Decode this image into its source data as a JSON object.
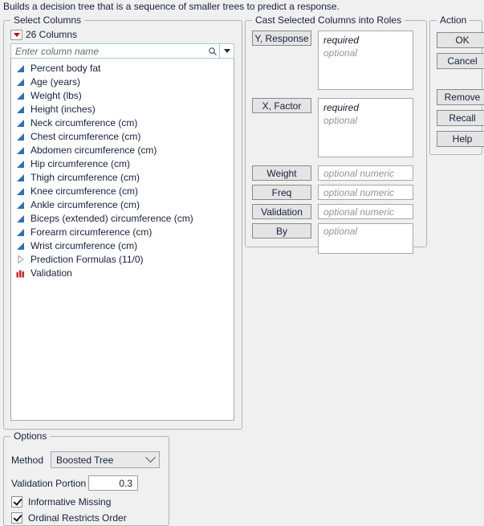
{
  "description": "Builds a decision tree that is a sequence of smaller trees to predict a response.",
  "select_columns": {
    "legend": "Select Columns",
    "column_count_label": "26 Columns",
    "search_placeholder": "Enter column name",
    "search_value": "",
    "items": [
      {
        "label": "Percent body fat",
        "icon": "continuous-icon"
      },
      {
        "label": "Age (years)",
        "icon": "continuous-icon"
      },
      {
        "label": "Weight (lbs)",
        "icon": "continuous-icon"
      },
      {
        "label": "Height (inches)",
        "icon": "continuous-icon"
      },
      {
        "label": "Neck circumference (cm)",
        "icon": "continuous-icon"
      },
      {
        "label": "Chest circumference (cm)",
        "icon": "continuous-icon"
      },
      {
        "label": "Abdomen circumference (cm)",
        "icon": "continuous-icon"
      },
      {
        "label": "Hip circumference (cm)",
        "icon": "continuous-icon"
      },
      {
        "label": "Thigh circumference (cm)",
        "icon": "continuous-icon"
      },
      {
        "label": "Knee circumference (cm)",
        "icon": "continuous-icon"
      },
      {
        "label": "Ankle circumference (cm)",
        "icon": "continuous-icon"
      },
      {
        "label": "Biceps (extended) circumference (cm)",
        "icon": "continuous-icon"
      },
      {
        "label": "Forearm circumference (cm)",
        "icon": "continuous-icon"
      },
      {
        "label": "Wrist circumference (cm)",
        "icon": "continuous-icon"
      },
      {
        "label": "Prediction Formulas (11/0)",
        "icon": "disclosure-triangle-icon"
      },
      {
        "label": "Validation",
        "icon": "nominal-bars-icon"
      }
    ]
  },
  "cast_roles": {
    "legend": "Cast Selected Columns into Roles",
    "roles": [
      {
        "button": "Y, Response",
        "hints": [
          "required",
          "optional"
        ]
      },
      {
        "button": "X, Factor",
        "hints": [
          "required",
          "optional"
        ]
      },
      {
        "button": "Weight",
        "hints": [
          "optional numeric"
        ]
      },
      {
        "button": "Freq",
        "hints": [
          "optional numeric"
        ]
      },
      {
        "button": "Validation",
        "hints": [
          "optional numeric"
        ]
      },
      {
        "button": "By",
        "hints": [
          "optional"
        ]
      }
    ]
  },
  "action": {
    "legend": "Action",
    "buttons": [
      "OK",
      "Cancel",
      "Remove",
      "Recall",
      "Help"
    ]
  },
  "options": {
    "legend": "Options",
    "method_label": "Method",
    "method_value": "Boosted Tree",
    "validation_portion_label": "Validation Portion",
    "validation_portion_value": "0.3",
    "checkboxes": [
      {
        "label": "Informative Missing",
        "checked": true
      },
      {
        "label": "Ordinal Restricts Order",
        "checked": true
      }
    ]
  },
  "colors": {
    "background": "#f0f0f0",
    "continuous_icon": "#2f6fb5",
    "nominal_icon": "#cc2222",
    "red_triangle": "#cc0000",
    "text": "#16213a"
  }
}
